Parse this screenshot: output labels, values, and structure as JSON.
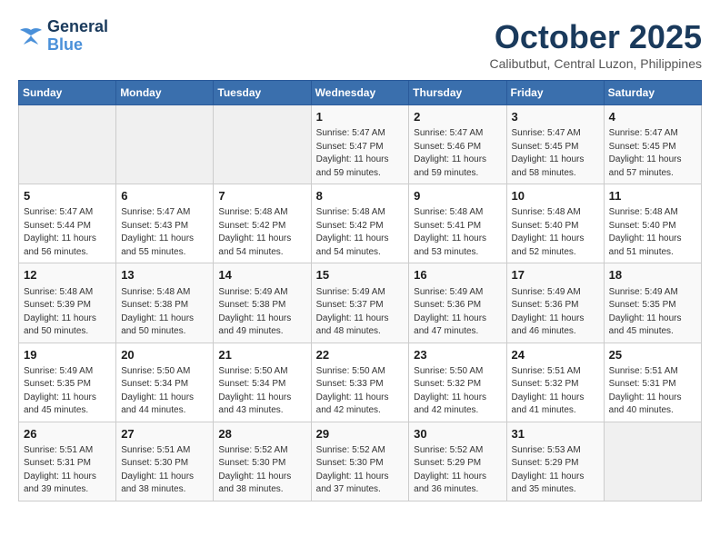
{
  "logo": {
    "line1": "General",
    "line2": "Blue"
  },
  "title": "October 2025",
  "subtitle": "Calibutbut, Central Luzon, Philippines",
  "weekdays": [
    "Sunday",
    "Monday",
    "Tuesday",
    "Wednesday",
    "Thursday",
    "Friday",
    "Saturday"
  ],
  "weeks": [
    [
      {
        "day": "",
        "info": ""
      },
      {
        "day": "",
        "info": ""
      },
      {
        "day": "",
        "info": ""
      },
      {
        "day": "1",
        "info": "Sunrise: 5:47 AM\nSunset: 5:47 PM\nDaylight: 11 hours\nand 59 minutes."
      },
      {
        "day": "2",
        "info": "Sunrise: 5:47 AM\nSunset: 5:46 PM\nDaylight: 11 hours\nand 59 minutes."
      },
      {
        "day": "3",
        "info": "Sunrise: 5:47 AM\nSunset: 5:45 PM\nDaylight: 11 hours\nand 58 minutes."
      },
      {
        "day": "4",
        "info": "Sunrise: 5:47 AM\nSunset: 5:45 PM\nDaylight: 11 hours\nand 57 minutes."
      }
    ],
    [
      {
        "day": "5",
        "info": "Sunrise: 5:47 AM\nSunset: 5:44 PM\nDaylight: 11 hours\nand 56 minutes."
      },
      {
        "day": "6",
        "info": "Sunrise: 5:47 AM\nSunset: 5:43 PM\nDaylight: 11 hours\nand 55 minutes."
      },
      {
        "day": "7",
        "info": "Sunrise: 5:48 AM\nSunset: 5:42 PM\nDaylight: 11 hours\nand 54 minutes."
      },
      {
        "day": "8",
        "info": "Sunrise: 5:48 AM\nSunset: 5:42 PM\nDaylight: 11 hours\nand 54 minutes."
      },
      {
        "day": "9",
        "info": "Sunrise: 5:48 AM\nSunset: 5:41 PM\nDaylight: 11 hours\nand 53 minutes."
      },
      {
        "day": "10",
        "info": "Sunrise: 5:48 AM\nSunset: 5:40 PM\nDaylight: 11 hours\nand 52 minutes."
      },
      {
        "day": "11",
        "info": "Sunrise: 5:48 AM\nSunset: 5:40 PM\nDaylight: 11 hours\nand 51 minutes."
      }
    ],
    [
      {
        "day": "12",
        "info": "Sunrise: 5:48 AM\nSunset: 5:39 PM\nDaylight: 11 hours\nand 50 minutes."
      },
      {
        "day": "13",
        "info": "Sunrise: 5:48 AM\nSunset: 5:38 PM\nDaylight: 11 hours\nand 50 minutes."
      },
      {
        "day": "14",
        "info": "Sunrise: 5:49 AM\nSunset: 5:38 PM\nDaylight: 11 hours\nand 49 minutes."
      },
      {
        "day": "15",
        "info": "Sunrise: 5:49 AM\nSunset: 5:37 PM\nDaylight: 11 hours\nand 48 minutes."
      },
      {
        "day": "16",
        "info": "Sunrise: 5:49 AM\nSunset: 5:36 PM\nDaylight: 11 hours\nand 47 minutes."
      },
      {
        "day": "17",
        "info": "Sunrise: 5:49 AM\nSunset: 5:36 PM\nDaylight: 11 hours\nand 46 minutes."
      },
      {
        "day": "18",
        "info": "Sunrise: 5:49 AM\nSunset: 5:35 PM\nDaylight: 11 hours\nand 45 minutes."
      }
    ],
    [
      {
        "day": "19",
        "info": "Sunrise: 5:49 AM\nSunset: 5:35 PM\nDaylight: 11 hours\nand 45 minutes."
      },
      {
        "day": "20",
        "info": "Sunrise: 5:50 AM\nSunset: 5:34 PM\nDaylight: 11 hours\nand 44 minutes."
      },
      {
        "day": "21",
        "info": "Sunrise: 5:50 AM\nSunset: 5:34 PM\nDaylight: 11 hours\nand 43 minutes."
      },
      {
        "day": "22",
        "info": "Sunrise: 5:50 AM\nSunset: 5:33 PM\nDaylight: 11 hours\nand 42 minutes."
      },
      {
        "day": "23",
        "info": "Sunrise: 5:50 AM\nSunset: 5:32 PM\nDaylight: 11 hours\nand 42 minutes."
      },
      {
        "day": "24",
        "info": "Sunrise: 5:51 AM\nSunset: 5:32 PM\nDaylight: 11 hours\nand 41 minutes."
      },
      {
        "day": "25",
        "info": "Sunrise: 5:51 AM\nSunset: 5:31 PM\nDaylight: 11 hours\nand 40 minutes."
      }
    ],
    [
      {
        "day": "26",
        "info": "Sunrise: 5:51 AM\nSunset: 5:31 PM\nDaylight: 11 hours\nand 39 minutes."
      },
      {
        "day": "27",
        "info": "Sunrise: 5:51 AM\nSunset: 5:30 PM\nDaylight: 11 hours\nand 38 minutes."
      },
      {
        "day": "28",
        "info": "Sunrise: 5:52 AM\nSunset: 5:30 PM\nDaylight: 11 hours\nand 38 minutes."
      },
      {
        "day": "29",
        "info": "Sunrise: 5:52 AM\nSunset: 5:30 PM\nDaylight: 11 hours\nand 37 minutes."
      },
      {
        "day": "30",
        "info": "Sunrise: 5:52 AM\nSunset: 5:29 PM\nDaylight: 11 hours\nand 36 minutes."
      },
      {
        "day": "31",
        "info": "Sunrise: 5:53 AM\nSunset: 5:29 PM\nDaylight: 11 hours\nand 35 minutes."
      },
      {
        "day": "",
        "info": ""
      }
    ]
  ]
}
